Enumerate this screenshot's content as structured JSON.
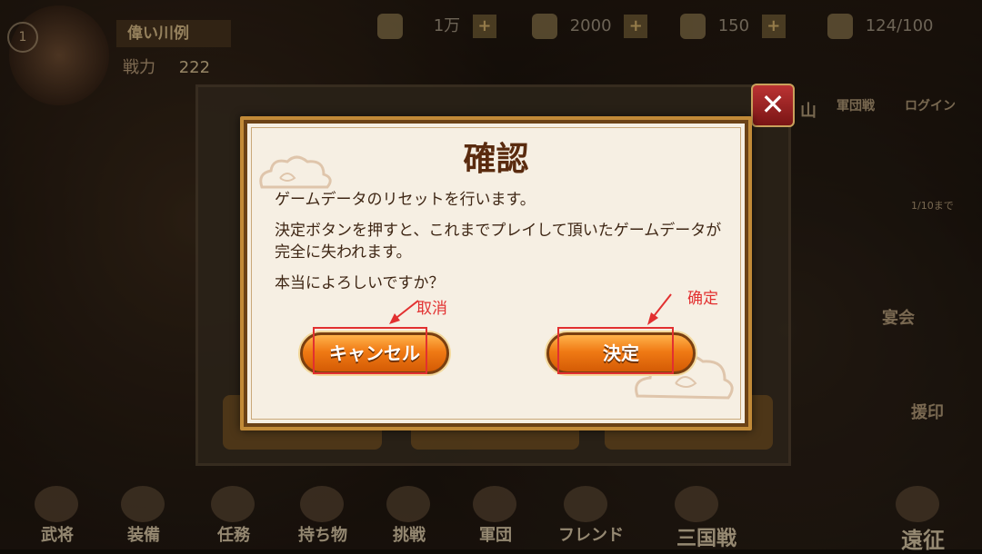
{
  "player": {
    "level": "1",
    "name": "偉い川例",
    "power_label": "戦力",
    "power_value": "222"
  },
  "resources": [
    {
      "icon": "coin-icon",
      "value": "1万"
    },
    {
      "icon": "scroll-icon",
      "value": "2000"
    },
    {
      "icon": "arrow-icon",
      "value": "150"
    },
    {
      "icon": "stamina-icon",
      "value": "124/100"
    }
  ],
  "side_right": {
    "items": [
      "山",
      "軍団戦",
      "ログイン",
      "宴会",
      "援印",
      "1/10まで"
    ]
  },
  "bottom_nav": [
    "武将",
    "装備",
    "任務",
    "持ち物",
    "挑戦",
    "軍団",
    "フレンド",
    "三国戦",
    "遠征"
  ],
  "dialog": {
    "title": "確認",
    "line1": "ゲームデータのリセットを行います。",
    "line2": "決定ボタンを押すと、これまでプレイして頂いたゲームデータが完全に失われます。",
    "line3": "本当によろしいですか？",
    "cancel_label": "キャンセル",
    "confirm_label": "決定"
  },
  "annotations": {
    "cancel_note": "取消",
    "confirm_note": "确定",
    "color": "#e23030"
  },
  "close_label": "✕"
}
